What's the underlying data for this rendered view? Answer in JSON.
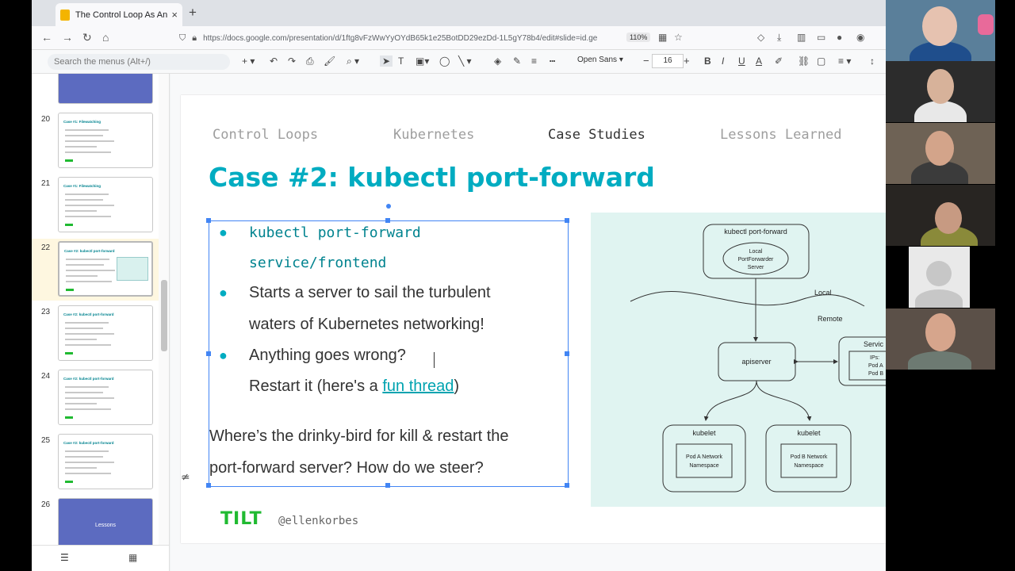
{
  "browser": {
    "tab_title": "The Control Loop As An Applic",
    "url": "https://docs.google.com/presentation/d/1ftg8vFzWwYyOYdB65k1e25BotDD29ezDd-1L5gY78b4/edit#slide=id.ge",
    "zoom": "110%"
  },
  "toolbar": {
    "menu_search_placeholder": "Search the menus (Alt+/)",
    "font": "Open Sans",
    "font_size": "16"
  },
  "filmstrip": [
    {
      "num": "20",
      "title": "Case #1: Filewatching",
      "selected": false,
      "purple": false
    },
    {
      "num": "21",
      "title": "Case #1: Filewatching",
      "selected": false,
      "purple": false
    },
    {
      "num": "22",
      "title": "Case #2: kubectl port-forward",
      "selected": true,
      "purple": false
    },
    {
      "num": "23",
      "title": "Case #2: kubectl port-forward",
      "selected": false,
      "purple": false
    },
    {
      "num": "24",
      "title": "Case #2: kubectl port-forward",
      "selected": false,
      "purple": false
    },
    {
      "num": "25",
      "title": "Case #2: kubectl port-forward",
      "selected": false,
      "purple": false
    },
    {
      "num": "26",
      "title": "Lessons",
      "selected": false,
      "purple": true
    }
  ],
  "slide": {
    "nav": [
      "Control Loops",
      "Kubernetes",
      "Case Studies",
      "Lessons Learned"
    ],
    "active_nav": "Case Studies",
    "title": "Case #2: kubectl port-forward",
    "bullet1_line1": "kubectl port-forward",
    "bullet1_line2": "service/frontend",
    "bullet2_line1": "Starts a server to sail the turbulent",
    "bullet2_line2": "waters of Kubernetes networking!",
    "bullet3_line1": "Anything goes wrong?",
    "bullet3_line2_prefix": "Restart it (here's a ",
    "bullet3_link": "fun thread",
    "bullet3_line2_suffix": ")",
    "para_line1": "Where’s the drinky-bird for kill & restart the",
    "para_line2": "port-forward server? How do we steer?",
    "logo": "TILT",
    "handle": "@ellenkorbes"
  },
  "diagram": {
    "top_box_title": "kubectl port-forward",
    "local_server": [
      "Local",
      "PortForwarder",
      "Server"
    ],
    "local": "Local",
    "remote": "Remote",
    "apiserver": "apiserver",
    "service_title": "Servic",
    "ips": [
      "IPs:",
      "Pod A",
      "Pod B"
    ],
    "kubelet_a": "kubelet",
    "kubelet_b": "kubelet",
    "ns_a": [
      "Pod A Network",
      "Namespace"
    ],
    "ns_b": [
      "Pod B Network",
      "Namespace"
    ]
  },
  "colors": {
    "accent": "#00acc1",
    "diagram_bg": "#e0f4f1",
    "selection": "#4285f4",
    "tilt": "#20ba31"
  }
}
